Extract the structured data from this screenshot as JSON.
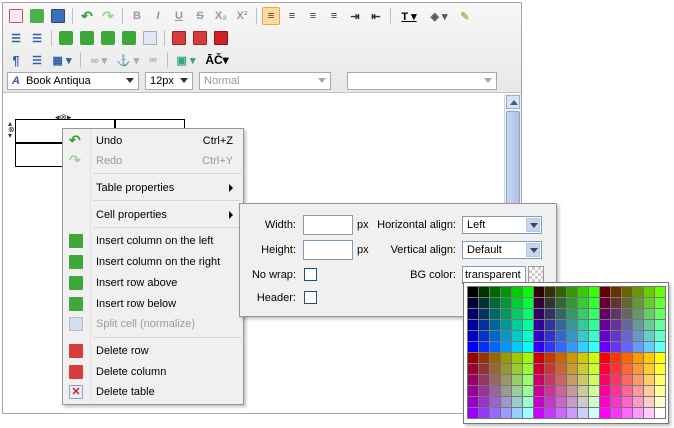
{
  "toolbar": {
    "font_family": "Book Antiqua",
    "font_size": "12px",
    "paragraph_format": "Normal",
    "style_select": "",
    "special_char": "ĀČ"
  },
  "context_menu": {
    "items": [
      {
        "label": "Undo",
        "shortcut": "Ctrl+Z",
        "disabled": false
      },
      {
        "label": "Redo",
        "shortcut": "Ctrl+Y",
        "disabled": true
      },
      {
        "label": "Table properties",
        "submenu": true
      },
      {
        "label": "Cell properties",
        "submenu": true
      },
      {
        "label": "Insert column on the left"
      },
      {
        "label": "Insert column on the right"
      },
      {
        "label": "Insert row above"
      },
      {
        "label": "Insert row below"
      },
      {
        "label": "Split cell (normalize)",
        "disabled": true
      },
      {
        "label": "Delete row"
      },
      {
        "label": "Delete column"
      },
      {
        "label": "Delete table"
      }
    ]
  },
  "cell_properties": {
    "width_label": "Width:",
    "width_value": "",
    "width_unit": "px",
    "height_label": "Height:",
    "height_value": "",
    "height_unit": "px",
    "nowrap_label": "No wrap:",
    "header_label": "Header:",
    "halign_label": "Horizontal align:",
    "halign_value": "Left",
    "valign_label": "Vertical align:",
    "valign_value": "Default",
    "bgcolor_label": "BG color:",
    "bgcolor_value": "transparent"
  },
  "colors": {
    "menu_bg": "#f0f0f0",
    "highlight": "#fbdc9c",
    "accent": "#3fa83a"
  }
}
